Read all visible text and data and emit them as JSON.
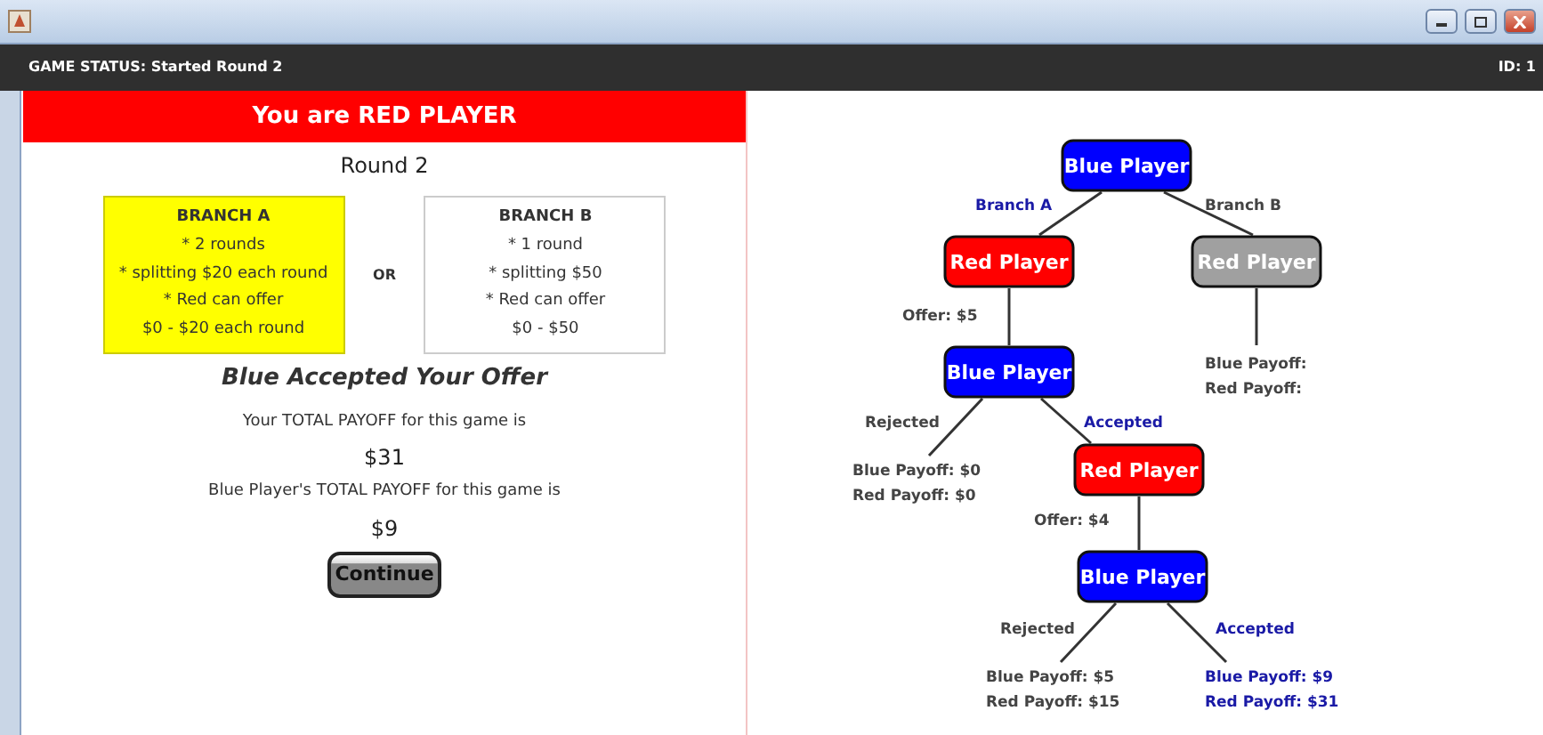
{
  "status_bar": {
    "status": "GAME STATUS:  Started Round 2",
    "id": "ID: 1"
  },
  "panel": {
    "header": "You are RED PLAYER",
    "round": "Round 2",
    "branches": [
      {
        "title": "BRANCH A",
        "lines": [
          "* 2 rounds",
          "* splitting $20 each round",
          "* Red can offer",
          "$0 - $20 each round"
        ],
        "selected": true
      },
      {
        "title": "BRANCH B",
        "lines": [
          "* 1 round",
          "* splitting $50",
          "* Red can offer",
          "$0 - $50"
        ],
        "selected": false
      }
    ],
    "or": "OR",
    "result": "Blue Accepted Your Offer",
    "payoffs": [
      {
        "label": "Your TOTAL PAYOFF for this game is",
        "amount": "$31"
      },
      {
        "label": "Blue Player's TOTAL PAYOFF for this game is",
        "amount": "$9"
      }
    ],
    "button": "Continue"
  },
  "tree": {
    "nodes": [
      {
        "label": "Blue Player",
        "color": "#0000ff"
      },
      {
        "label": "Red Player",
        "color": "#ff0000"
      },
      {
        "label": "Red Player",
        "color": "#a0a0a0"
      },
      {
        "label": "Blue Player",
        "color": "#0000ff"
      },
      {
        "label": "Red Player",
        "color": "#ff0000"
      },
      {
        "label": "Blue Player",
        "color": "#0000ff"
      }
    ],
    "edge_labels": [
      {
        "text": "Branch A",
        "selected": true
      },
      {
        "text": "Branch B",
        "selected": false
      },
      {
        "text": "Rejected",
        "selected": false
      },
      {
        "text": "Accepted",
        "selected": true
      },
      {
        "text": "Rejected",
        "selected": false
      },
      {
        "text": "Accepted",
        "selected": true
      }
    ],
    "offers": [
      "Offer: $5",
      "Offer: $4"
    ],
    "outcomes": [
      {
        "lines": [
          "Blue Payoff:",
          "Red Payoff:"
        ],
        "selected": false
      },
      {
        "lines": [
          "Blue Payoff: $0",
          "Red Payoff: $0"
        ],
        "selected": false
      },
      {
        "lines": [
          "Blue Payoff: $5",
          "Red Payoff: $15"
        ],
        "selected": false
      },
      {
        "lines": [
          "Blue Payoff: $9",
          "Red Payoff: $31"
        ],
        "selected": true
      }
    ]
  }
}
